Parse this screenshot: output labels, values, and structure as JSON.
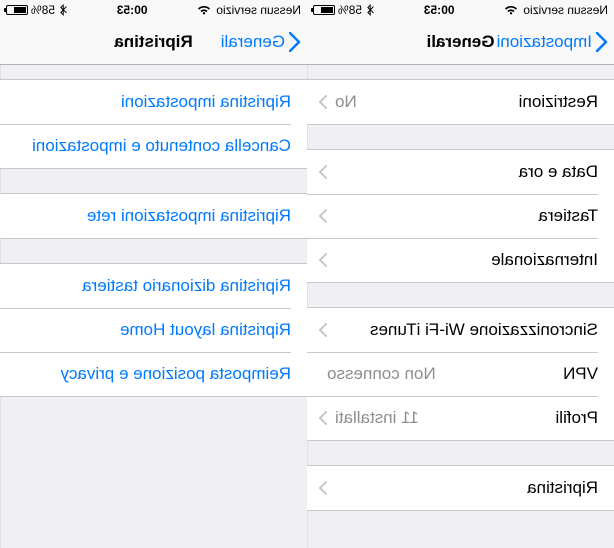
{
  "statusbar": {
    "carrier": "Nessun servizio",
    "time": "00:53",
    "battery": "58%",
    "battery_fill_pct": 58
  },
  "right": {
    "back_label": "Impostazioni",
    "title": "Generali",
    "groups": [
      {
        "cells": [
          {
            "name": "cell-restrizioni",
            "label": "Restrizioni",
            "detail": "No",
            "chevron": true
          }
        ]
      },
      {
        "cells": [
          {
            "name": "cell-data-e-ora",
            "label": "Data e ora",
            "chevron": true
          },
          {
            "name": "cell-tastiera",
            "label": "Tastiera",
            "chevron": true
          },
          {
            "name": "cell-internazionale",
            "label": "Internazionale",
            "chevron": true
          }
        ]
      },
      {
        "cells": [
          {
            "name": "cell-sync-wifi-itunes",
            "label": "Sincronizzazione Wi-Fi iTunes",
            "chevron": true
          },
          {
            "name": "cell-vpn",
            "label": "VPN",
            "detail": "Non connesso"
          },
          {
            "name": "cell-profili",
            "label": "Profili",
            "detail": "11 installati",
            "chevron": true
          }
        ]
      },
      {
        "cells": [
          {
            "name": "cell-ripristina",
            "label": "Ripristina",
            "chevron": true
          }
        ]
      }
    ]
  },
  "left": {
    "back_label": "Generali",
    "title": "Ripristina",
    "groups": [
      {
        "cells": [
          {
            "name": "action-ripristina-impostazioni",
            "label": "Ripristina impostazioni"
          },
          {
            "name": "action-cancella-contenuto",
            "label": "Cancella contenuto e impostazioni"
          }
        ]
      },
      {
        "cells": [
          {
            "name": "action-ripristina-impostazioni-rete",
            "label": "Ripristina impostazioni rete"
          }
        ]
      },
      {
        "cells": [
          {
            "name": "action-ripristina-dizionario",
            "label": "Ripristina dizionario tastiera"
          },
          {
            "name": "action-ripristina-layout-home",
            "label": "Ripristina layout Home"
          },
          {
            "name": "action-reimposta-posizione-privacy",
            "label": "Reimposta posizione e privacy"
          }
        ]
      }
    ]
  }
}
